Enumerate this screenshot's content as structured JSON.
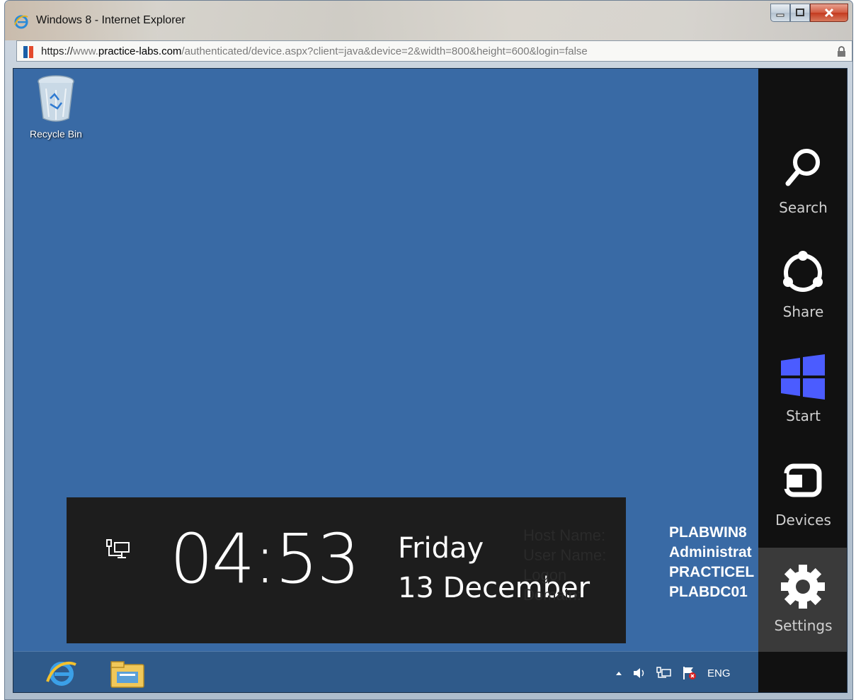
{
  "window": {
    "title": "Windows 8 - Internet Explorer"
  },
  "address": {
    "scheme": "https://",
    "prefix": "www.",
    "domain": "practice-labs.com",
    "path": "/authenticated/device.aspx?client=java&device=2&width=800&height=600&login=false"
  },
  "desktop": {
    "recycle_bin_label": "Recycle Bin"
  },
  "clock": {
    "time": "04:53",
    "day": "Friday",
    "date": "13 December",
    "info_labels": [
      "Host Name:",
      "User Name:",
      "Logon Domain:"
    ],
    "info_values": [
      "PLABWIN8",
      "Administrat",
      "PRACTICEL",
      "PLABDC01"
    ]
  },
  "taskbar": {
    "language": "ENG",
    "pinned": [
      "internet-explorer-icon",
      "file-explorer-icon"
    ]
  },
  "charms": {
    "search": "Search",
    "share": "Share",
    "start": "Start",
    "devices": "Devices",
    "settings": "Settings",
    "active": "Settings"
  },
  "colors": {
    "desktop": "#396aa5",
    "charms_bg": "#111111",
    "start_logo": "#4b5cff",
    "clock_panel": "#1d1d1d"
  }
}
